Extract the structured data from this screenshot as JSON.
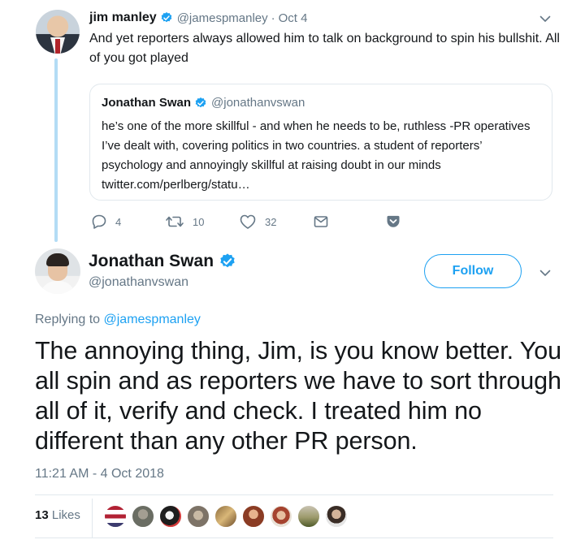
{
  "parent_tweet": {
    "name": "jim manley",
    "handle": "@jamespmanley",
    "dot": "·",
    "date": "Oct 4",
    "text": "And yet reporters always allowed him to talk on background  to spin his bullshit. All of you got played",
    "quoted": {
      "name": "Jonathan Swan",
      "handle": "@jonathanvswan",
      "text": "he’s one of the more skillful - and when he needs to be, ruthless -PR operatives I’ve dealt with, covering politics in two countries. a student of reporters’ psychology and annoyingly skillful at raising doubt in our minds twitter.com/perlberg/statu…"
    },
    "actions": {
      "reply_count": "4",
      "retweet_count": "10",
      "like_count": "32"
    }
  },
  "main_tweet": {
    "name": "Jonathan Swan",
    "handle": "@jonathanvswan",
    "follow_label": "Follow",
    "replying_prefix": "Replying to",
    "replying_to": "@jamespmanley",
    "text": "The annoying thing, Jim, is you know better. You all spin and as reporters we have to sort through all of it, verify and check. I treated him no different than any other PR person.",
    "timestamp": "11:21 AM - 4 Oct 2018",
    "likes_count": "13",
    "likes_label": "Likes"
  },
  "icons": {
    "verified": "verified-badge-icon",
    "chevron": "chevron-down-icon",
    "reply": "reply-icon",
    "retweet": "retweet-icon",
    "like": "heart-icon",
    "dm": "envelope-icon",
    "pocket": "pocket-icon"
  },
  "colors": {
    "accent": "#1da1f2",
    "secondary_text": "#657786",
    "thread_line": "#b3dcf5",
    "border": "#e1e8ed"
  }
}
